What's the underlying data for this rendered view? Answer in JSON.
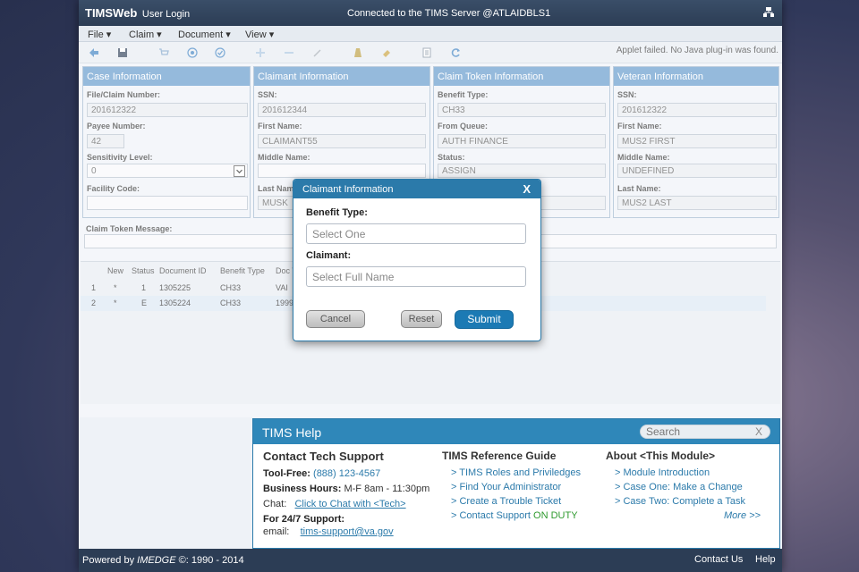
{
  "titlebar": {
    "app_name": "TIMSWeb",
    "subtitle": "User Login",
    "server": "Connected to the TIMS Server @ATLAIDBLS1"
  },
  "menu": [
    "File ▾",
    "Claim ▾",
    "Document ▾",
    "View ▾"
  ],
  "toolbar": {
    "applet_message": "Applet failed. No Java plug-in was found.",
    "icons": [
      "back-arrow-icon",
      "save-icon",
      "cart-icon",
      "gear-circle-icon",
      "check-circle-icon",
      "plus-icon",
      "minus-icon",
      "pencil-icon",
      "flask-icon",
      "tag-icon",
      "document-icon",
      "refresh-icon"
    ]
  },
  "panels": {
    "case": {
      "title": "Case Information",
      "file_claim_label": "File/Claim Number:",
      "file_claim_value": "201612322",
      "payee_label": "Payee Number:",
      "payee_value": "42",
      "sensitivity_label": "Sensitivity Level:",
      "sensitivity_value": "0",
      "facility_label": "Facility Code:",
      "facility_value": ""
    },
    "claimant": {
      "title": "Claimant Information",
      "ssn_label": "SSN:",
      "ssn_value": "201612344",
      "first_label": "First Name:",
      "first_value": "CLAIMANT55",
      "middle_label": "Middle Name:",
      "middle_value": "",
      "last_label": "Last Name:",
      "last_value": "MUSK"
    },
    "token": {
      "title": "Claim Token Information",
      "benefit_label": "Benefit Type:",
      "benefit_value": "CH33",
      "queue_label": "From Queue:",
      "queue_value": "AUTH FINANCE",
      "status_label": "Status:",
      "status_value": "ASSIGN"
    },
    "veteran": {
      "title": "Veteran Information",
      "ssn_label": "SSN:",
      "ssn_value": "201612322",
      "first_label": "First Name:",
      "first_value": "MUS2 FIRST",
      "middle_label": "Middle Name:",
      "middle_value": "UNDEFINED",
      "last_label": "Last Name:",
      "last_value": "MUS2 LAST"
    }
  },
  "token_message_label": "Claim Token Message:",
  "grid": {
    "headers": [
      "New",
      "Status",
      "Document ID",
      "Benefit Type",
      "Doc T"
    ],
    "rows": [
      [
        "1",
        "*",
        "1",
        "1305225",
        "CH33",
        "VAI"
      ],
      [
        "2",
        "*",
        "E",
        "1305224",
        "CH33",
        "1999"
      ]
    ]
  },
  "modal": {
    "title": "Claimant Information",
    "close": "X",
    "benefit_label": "Benefit Type:",
    "benefit_placeholder": "Select One",
    "claimant_label": "Claimant:",
    "claimant_placeholder": "Select Full Name",
    "cancel": "Cancel",
    "reset": "Reset",
    "submit": "Submit"
  },
  "help": {
    "title": "TIMS Help",
    "search_placeholder": "Search",
    "search_clear": "X",
    "contact": {
      "heading": "Contact Tech Support",
      "tollfree_label": "Tool-Free:",
      "tollfree_value": "(888) 123-4567",
      "hours_label": "Business Hours:",
      "hours_value": "M-F 8am - 11:30pm",
      "chat_label": "Chat:",
      "chat_link": "Click to Chat with <Tech>",
      "support_label": "For 24/7 Support:",
      "email_label": "email:",
      "email_link": "tims-support@va.gov"
    },
    "guide": {
      "heading": "TIMS Reference Guide",
      "links": [
        "> TIMS Roles and Priviledges",
        "> Find Your Administrator",
        "> Create a Trouble Ticket",
        "> Contact Support"
      ],
      "on_duty": "ON DUTY"
    },
    "about": {
      "heading": "About <This Module>",
      "links": [
        "> Module Introduction",
        "> Case One: Make a Change",
        "> Case Two: Complete a Task"
      ],
      "more": "More >>"
    }
  },
  "footer": {
    "powered_prefix": "Powered by",
    "powered_brand": "IMEDGE",
    "powered_suffix": "©: 1990 - 2014",
    "contact": "Contact Us",
    "help": "Help"
  },
  "colors": {
    "header_bg": "#2c3d55",
    "panel_header": "#5c95c9",
    "modal_accent": "#2b7aaa",
    "submit": "#1c7ab4",
    "on_duty": "#2e9a2e"
  }
}
